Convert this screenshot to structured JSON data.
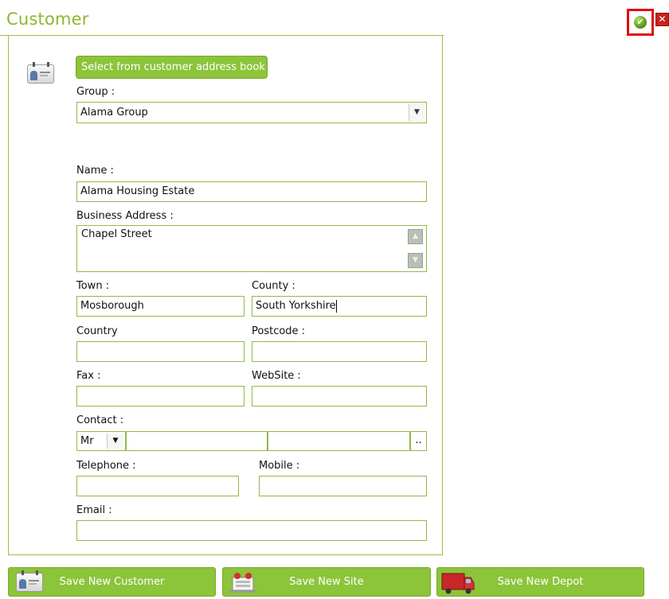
{
  "window": {
    "title": "Customer"
  },
  "actions": {
    "ok_symbol": "✔",
    "close_symbol": "✕"
  },
  "address_book_button": "Select from customer address book",
  "form": {
    "group_label": "Group :",
    "group_value": "Alama Group",
    "name_label": "Name :",
    "name_value": "Alama Housing Estate",
    "business_address_label": "Business Address :",
    "business_address_value": "Chapel Street",
    "town_label": "Town :",
    "town_value": "Mosborough",
    "county_label": "County :",
    "county_value": "South Yorkshire",
    "country_label": "Country",
    "country_value": "",
    "postcode_label": "Postcode :",
    "postcode_value": "",
    "fax_label": "Fax :",
    "fax_value": "",
    "website_label": "WebSite :",
    "website_value": "",
    "contact_label": "Contact :",
    "contact_title": "Mr",
    "contact_first": "",
    "contact_last": "",
    "contact_more": "..",
    "telephone_label": "Telephone :",
    "telephone_value": "",
    "mobile_label": "Mobile :",
    "mobile_value": "",
    "email_label": "Email :",
    "email_value": ""
  },
  "bottom_buttons": {
    "customer": "Save New Customer",
    "site": "Save New Site",
    "depot": "Save New Depot"
  },
  "colors": {
    "accent": "#8cc43a",
    "border": "#93b84a",
    "title": "#8cb832",
    "highlight": "#e01010"
  }
}
